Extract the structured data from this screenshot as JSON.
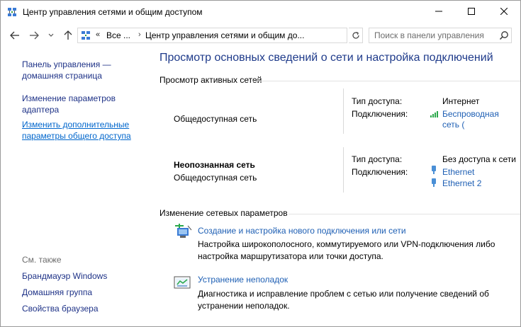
{
  "window": {
    "title": "Центр управления сетями и общим доступом"
  },
  "address": {
    "overflow": "«",
    "root": "Все ...",
    "current": "Центр управления сетями и общим до..."
  },
  "search": {
    "placeholder": "Поиск в панели управления"
  },
  "left_pane": {
    "links": [
      {
        "label_line1": "Панель управления —",
        "label_line2": "домашняя страница"
      },
      {
        "label_line1": "Изменение параметров",
        "label_line2": "адаптера"
      },
      {
        "label_line1": "Изменить дополнительные",
        "label_line2": "параметры общего доступа"
      }
    ],
    "see_also": {
      "heading": "См. также",
      "links": [
        "Брандмауэр Windows",
        "Домашняя группа",
        "Свойства браузера"
      ]
    }
  },
  "main": {
    "title": "Просмотр основных сведений о сети и настройка подключений",
    "active_networks_heading": "Просмотр активных сетей",
    "networks": [
      {
        "name": "",
        "type": "Общедоступная сеть",
        "access_label": "Тип доступа:",
        "access_value": "Интернет",
        "connections_label": "Подключения:",
        "connections": [
          "Беспроводная",
          "сеть ("
        ],
        "connection_icon": "wifi-signal-icon"
      },
      {
        "name": "Неопознанная сеть",
        "type": "Общедоступная сеть",
        "access_label": "Тип доступа:",
        "access_value": "Без доступа к сети",
        "connections_label": "Подключения:",
        "connections": [
          "Ethernet",
          "Ethernet 2"
        ],
        "connection_icon": "ethernet-plug-icon"
      }
    ],
    "change_settings_heading": "Изменение сетевых параметров",
    "tasks": [
      {
        "link": "Создание и настройка нового подключения или сети",
        "desc": "Настройка широкополосного, коммутируемого или VPN-подключения либо настройка маршрутизатора или точки доступа.",
        "icon": "new-connection-icon"
      },
      {
        "link": "Устранение неполадок",
        "desc": "Диагностика и исправление проблем с сетью или получение сведений об устранении неполадок.",
        "icon": "troubleshoot-icon"
      }
    ]
  },
  "colors": {
    "link": "#1e5fb4",
    "title": "#1e3a8a",
    "left_link": "#1e3287"
  }
}
